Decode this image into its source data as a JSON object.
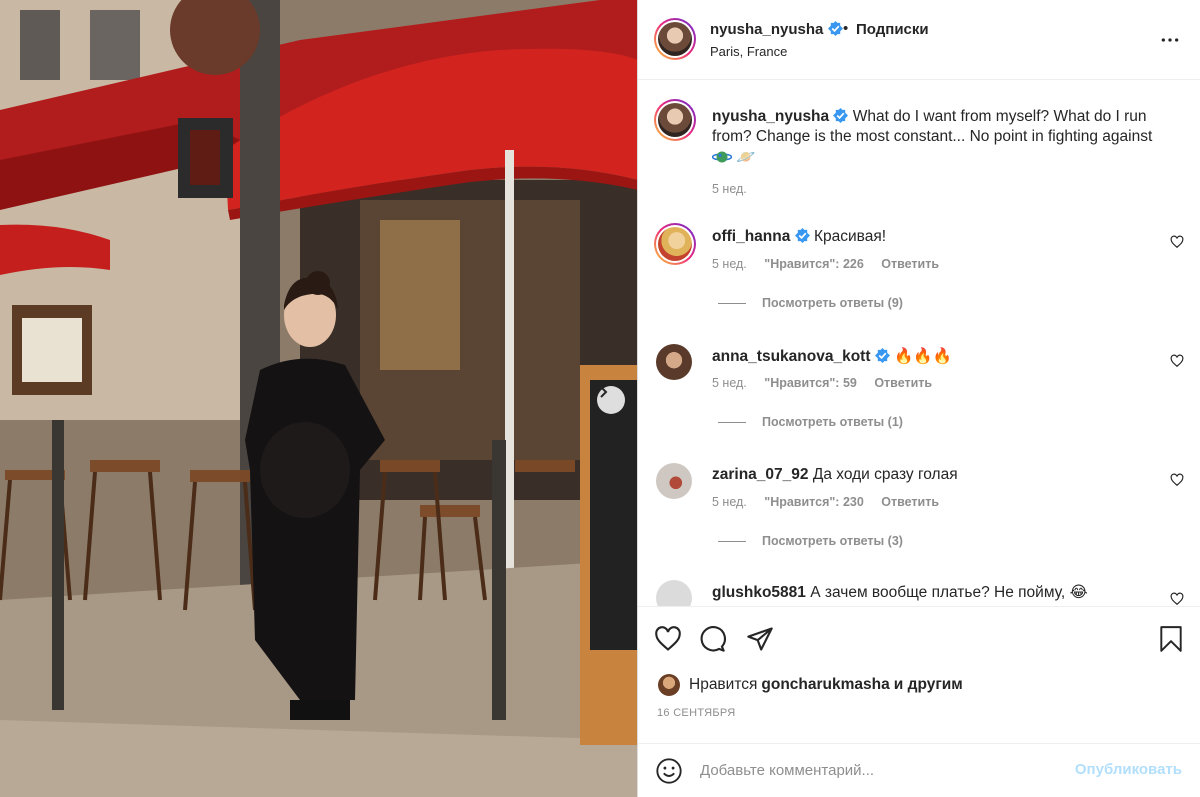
{
  "header": {
    "username": "nyusha_nyusha",
    "separator": "•",
    "follow_label": "Подписки",
    "location": "Paris, France"
  },
  "caption": {
    "username": "nyusha_nyusha",
    "text": "What do I want from myself? What do I run from? Change is the most constant... No point in fighting against",
    "emoji": "🪐",
    "time": "5 нед."
  },
  "comments": [
    {
      "username": "offi_hanna",
      "text": "Красивая!",
      "time": "5 нед.",
      "likes": "\"Нравится\": 226",
      "reply": "Ответить",
      "replies": "Посмотреть ответы (9)"
    },
    {
      "username": "anna_tsukanova_kott",
      "text": "🔥🔥🔥",
      "time": "5 нед.",
      "likes": "\"Нравится\": 59",
      "reply": "Ответить",
      "replies": "Посмотреть ответы (1)"
    },
    {
      "username": "zarina_07_92",
      "text": "Да ходи сразу голая",
      "time": "5 нед.",
      "likes": "\"Нравится\": 230",
      "reply": "Ответить",
      "replies": "Посмотреть ответы (3)"
    },
    {
      "username": "glushko5881",
      "text": "А зачем вообще платье? Не пойму, 😂"
    }
  ],
  "likes_line": {
    "prefix": "Нравится",
    "user": "goncharukmasha",
    "suffix": "и другим"
  },
  "date": "16 СЕНТЯБРЯ",
  "comment_box": {
    "placeholder": "Добавьте комментарий...",
    "publish_label": "Опубликовать"
  },
  "icons": {
    "like": "heart-icon",
    "comment": "speech-bubble-icon",
    "share": "paper-plane-icon",
    "save": "bookmark-icon",
    "more": "more-dots-icon",
    "emoji": "smiley-icon",
    "verified": "verified-badge-icon"
  },
  "colors": {
    "verified": "#3897f0",
    "publish_disabled": "#b2dffc",
    "secondary_text": "#8e8e8e"
  }
}
